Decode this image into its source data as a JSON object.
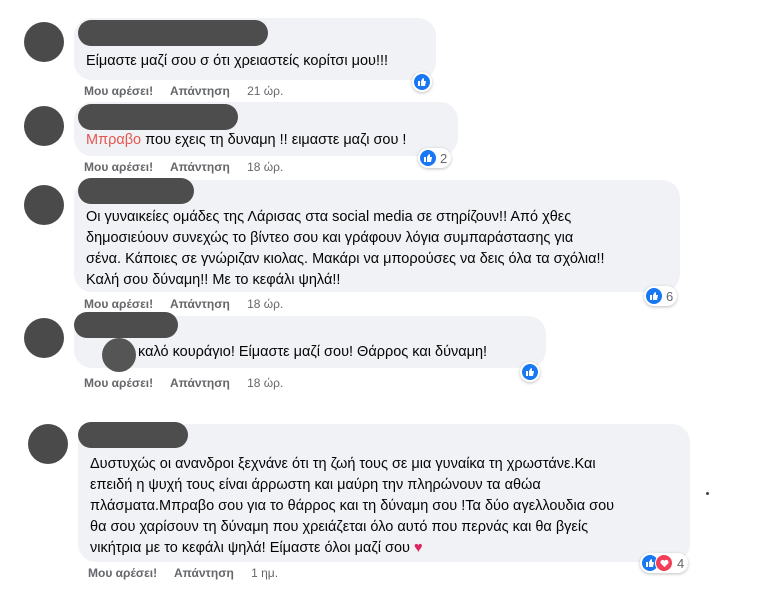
{
  "comments": [
    {
      "text": "Είμαστε μαζί σου σ ότι χρειαστείς κορίτσι μου!!!",
      "like": "Μου αρέσει!",
      "reply": "Απάντηση",
      "time": "21 ώρ.",
      "reaction_icon": "like-icon",
      "reaction_count": ""
    },
    {
      "name": "Μπραβο",
      "text": " που εχεις τη δυναμη !! ειμαστε μαζι σου !",
      "like": "Μου αρέσει!",
      "reply": "Απάντηση",
      "time": "18 ώρ.",
      "reaction_icon": "like-icon",
      "reaction_count": "2"
    },
    {
      "lines": [
        "Οι γυναικείες ομάδες της Λάρισας στα social media σε στηρίζουν!! Από χθες",
        "δημοσιεύουν συνεχώς το βίντεο σου και γράφουν λόγια συμπαράστασης για",
        "σένα. Κάποιες σε γνώριζαν κιολας. Μακάρι να μπορούσες να δεις όλα τα σχόλια!!",
        "Καλή σου δύναμη!! Με το κεφάλι ψηλά!!"
      ],
      "like": "Μου αρέσει!",
      "reply": "Απάντηση",
      "time": "18 ώρ.",
      "reaction_icon": "like-icon",
      "reaction_count": "6"
    },
    {
      "text": "καλό κουράγιο! Είμαστε μαζί σου! Θάρρος και δύναμη!",
      "like": "Μου αρέσει!",
      "reply": "Απάντηση",
      "time": "18 ώρ.",
      "reaction_icon": "like-icon",
      "reaction_count": ""
    },
    {
      "lines": [
        "Δυστυχώς οι ανανδροι ξεχνάνε ότι τη ζωή τους σε μια γυναίκα τη χρωστάνε.Και",
        "επειδή η ψυχή τους είναι άρρωστη και μαύρη την πληρώνουν τα αθώα",
        "πλάσματα.Μπραβο σου για το θάρρος και τη δύναμη σου !Τα δύο αγελλουδια σου",
        "θα σου χαρίσουν τη δύναμη που χρειάζεται όλο αυτό που περνάς και θα βγείς",
        "νικήτρια με το κεφάλι ψηλά! Είμαστε όλοι μαζί σου"
      ],
      "emoji": "♥",
      "like": "Μου αρέσει!",
      "reply": "Απάντηση",
      "time": "1 ημ.",
      "reaction_icon": "like-love-icons",
      "reaction_count": "4"
    }
  ],
  "colors": {
    "bubble": "#f0f2f5",
    "like_blue": "#1877f2",
    "name_highlight": "#e4574f",
    "meta_gray": "#65676b"
  }
}
